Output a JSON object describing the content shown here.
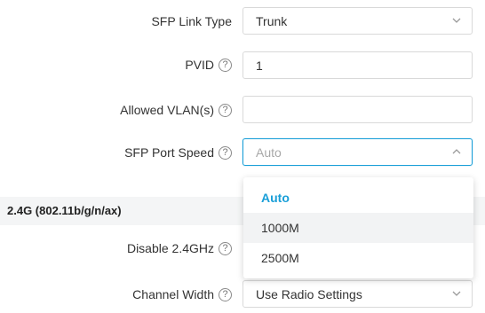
{
  "fields": {
    "sfp_link_type": {
      "label": "SFP Link Type",
      "value": "Trunk"
    },
    "pvid": {
      "label": "PVID",
      "value": "1"
    },
    "allowed_vlans": {
      "label": "Allowed VLAN(s)",
      "value": ""
    },
    "sfp_port_speed": {
      "label": "SFP Port Speed",
      "placeholder": "Auto"
    },
    "disable_24ghz": {
      "label": "Disable 2.4GHz"
    },
    "channel_width": {
      "label": "Channel Width",
      "value": "Use Radio Settings"
    }
  },
  "help_glyph": "?",
  "section": {
    "title": "2.4G (802.11b/g/n/ax)"
  },
  "dropdown": {
    "options": [
      "Auto",
      "1000M",
      "2500M"
    ],
    "selected": "Auto",
    "hovered": "1000M"
  },
  "colors": {
    "accent": "#1a9fd8",
    "section_bg": "#f4f5f6",
    "border": "#d9d9d9"
  },
  "icons": {
    "select_arrow": "chevron-down-icon",
    "open_select_arrow": "chevron-up-icon",
    "help": "help-circle-icon"
  }
}
